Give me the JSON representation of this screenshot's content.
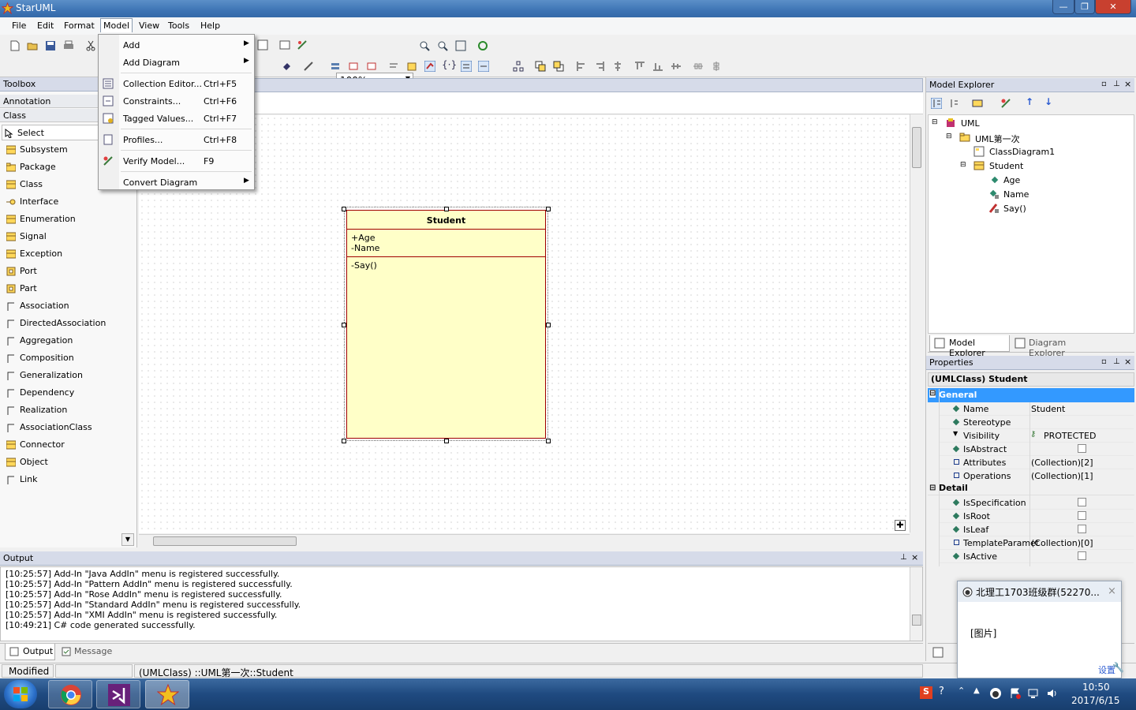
{
  "window": {
    "title": "StarUML"
  },
  "menubar": {
    "items": [
      "File",
      "Edit",
      "Format",
      "Model",
      "View",
      "Tools",
      "Help"
    ]
  },
  "toolbar": {
    "zoom": "100%",
    "font": "Tahoma"
  },
  "toolbox": {
    "title": "Toolbox",
    "sections": [
      "Annotation",
      "Class"
    ],
    "items": [
      "Select",
      "Subsystem",
      "Package",
      "Class",
      "Interface",
      "Enumeration",
      "Signal",
      "Exception",
      "Port",
      "Part",
      "Association",
      "DirectedAssociation",
      "Aggregation",
      "Composition",
      "Generalization",
      "Dependency",
      "Realization",
      "AssociationClass",
      "Connector",
      "Object",
      "Link"
    ]
  },
  "model_menu": {
    "items": [
      {
        "label": "Add",
        "shortcut": "",
        "arrow": "▶"
      },
      {
        "label": "Add Diagram",
        "shortcut": "",
        "arrow": "▶"
      },
      {
        "label": "Collection Editor...",
        "shortcut": "Ctrl+F5",
        "arrow": ""
      },
      {
        "label": "Constraints...",
        "shortcut": "Ctrl+F6",
        "arrow": ""
      },
      {
        "label": "Tagged Values...",
        "shortcut": "Ctrl+F7",
        "arrow": ""
      },
      {
        "label": "Profiles...",
        "shortcut": "Ctrl+F8",
        "arrow": ""
      },
      {
        "label": "Verify Model...",
        "shortcut": "F9",
        "arrow": ""
      },
      {
        "label": "Convert Diagram",
        "shortcut": "",
        "arrow": "▶"
      }
    ]
  },
  "diagram": {
    "class_name": "Student",
    "attributes": [
      "+Age",
      "-Name"
    ],
    "operations": [
      "-Say()"
    ]
  },
  "model_explorer": {
    "title": "Model Explorer",
    "tree": [
      "UML",
      "UML第一次",
      "ClassDiagram1",
      "Student",
      "Age",
      "Name",
      "Say()"
    ],
    "tabs": [
      "Model Explorer",
      "Diagram Explorer"
    ]
  },
  "properties": {
    "title": "Properties",
    "selected": "(UMLClass) Student",
    "groups": [
      "General",
      "Detail"
    ],
    "general": [
      {
        "name": "Name",
        "value": "Student"
      },
      {
        "name": "Stereotype",
        "value": ""
      },
      {
        "name": "Visibility",
        "value": "PROTECTED"
      },
      {
        "name": "IsAbstract",
        "value": ""
      },
      {
        "name": "Attributes",
        "value": "(Collection)[2]"
      },
      {
        "name": "Operations",
        "value": "(Collection)[1]"
      }
    ],
    "detail": [
      {
        "name": "IsSpecification",
        "value": ""
      },
      {
        "name": "IsRoot",
        "value": ""
      },
      {
        "name": "IsLeaf",
        "value": ""
      },
      {
        "name": "TemplateParamet",
        "value": "(Collection)[0]"
      },
      {
        "name": "IsActive",
        "value": ""
      }
    ]
  },
  "output": {
    "title": "Output",
    "lines": [
      "[10:25:57]  Add-In \"Java AddIn\" menu is registered successfully.",
      "[10:25:57]  Add-In \"Pattern AddIn\" menu is registered successfully.",
      "[10:25:57]  Add-In \"Rose AddIn\" menu is registered successfully.",
      "[10:25:57]  Add-In \"Standard AddIn\" menu is registered successfully.",
      "[10:25:57]  Add-In \"XMI AddIn\" menu is registered successfully.",
      "[10:49:21]  C# code generated successfully."
    ],
    "tabs": [
      "Output",
      "Message"
    ]
  },
  "statusbar": {
    "mode": "Modified",
    "path": "(UMLClass) ::UML第一次::Student"
  },
  "notification": {
    "title": "北理工1703班级群(52270...",
    "body": "[图片]",
    "setting": "设置"
  },
  "taskbar": {
    "time": "10:50",
    "date": "2017/6/15"
  },
  "colors": {
    "class_fill": "#ffffc8",
    "class_border": "#a00000",
    "selection": "#3399ff",
    "taskbar": "#1f4a80"
  }
}
